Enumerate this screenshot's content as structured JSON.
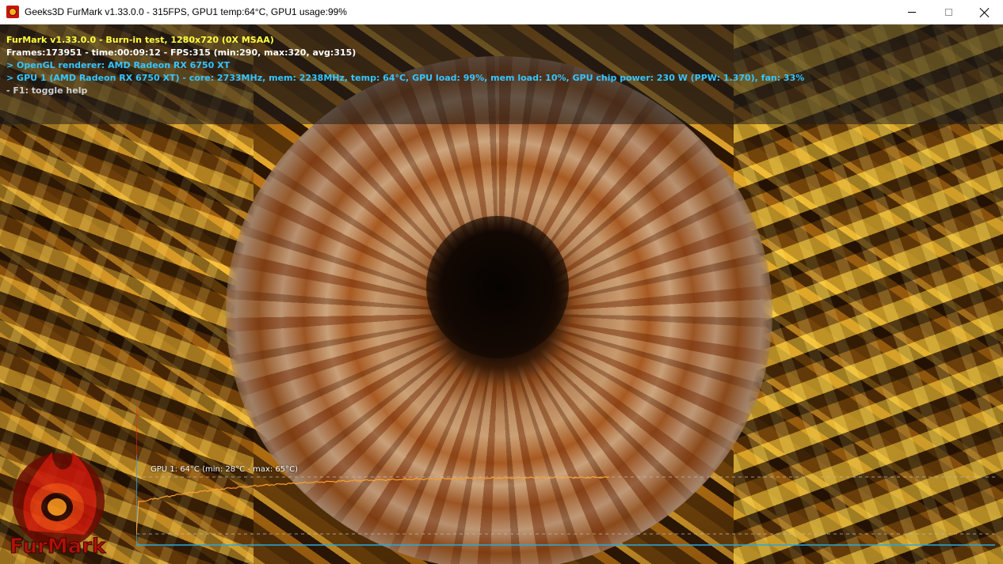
{
  "window": {
    "title": "Geeks3D FurMark v1.33.0.0 - 315FPS, GPU1 temp:64°C, GPU1 usage:99%",
    "icon": "furmark-app-icon",
    "controls": [
      "minimize",
      "maximize",
      "close"
    ]
  },
  "hud": {
    "line1": "FurMark v1.33.0.0 - Burn-in test, 1280x720 (0X MSAA)",
    "line2": "Frames:173951 - time:00:09:12 - FPS:315 (min:290, max:320, avg:315)",
    "line3": "> OpenGL renderer: AMD Radeon RX 6750 XT",
    "line4": "> GPU 1 (AMD Radeon RX 6750 XT) - core: 2733MHz, mem: 2238MHz, temp: 64°C, GPU load: 99%, mem load: 10%, GPU chip power: 230 W (PPW: 1.370), fan: 33%",
    "line5": "- F1: toggle help",
    "colors": {
      "title": "#ffff40",
      "stats": "#ffffff",
      "gpu_info": "#35c6ff",
      "help": "#d0d0d0"
    }
  },
  "graph": {
    "label": "GPU 1: 64°C (min: 28°C - max: 65°C)",
    "line_color": "#ffa030",
    "axis_color": "#2aa8d8",
    "marker_color": "#ff2020",
    "y_range": [
      0,
      100
    ]
  },
  "logo": {
    "text": "FurMark",
    "icon": "furmark-flame-logo"
  }
}
